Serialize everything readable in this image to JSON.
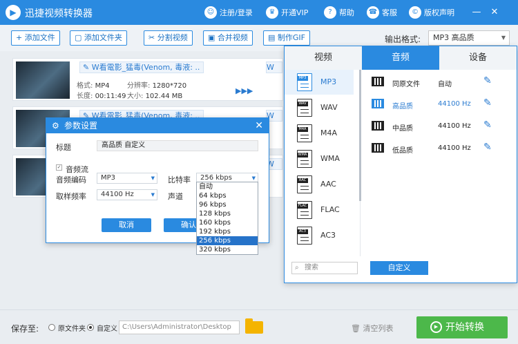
{
  "app": {
    "logo_glyph": "▶",
    "title": "迅捷视频转换器"
  },
  "titlebar": {
    "links": [
      {
        "icon": "user-icon",
        "glyph": "☺",
        "label": "注册/登录"
      },
      {
        "icon": "vip-icon",
        "glyph": "♛",
        "label": "开通VIP"
      },
      {
        "icon": "help-icon",
        "glyph": "?",
        "label": "帮助"
      },
      {
        "icon": "headset-icon",
        "glyph": "☎",
        "label": "客服"
      },
      {
        "icon": "copyright-icon",
        "glyph": "©",
        "label": "版权声明"
      }
    ],
    "minimize": "—",
    "close": "✕"
  },
  "toolbar": {
    "add_file": "+ 添加文件",
    "add_folder": "添加文件夹",
    "split_video": "分割视频",
    "merge_video": "合并视频",
    "make_gif": "制作GIF",
    "output_format_label": "输出格式:",
    "output_format_value": "MP3  高品质"
  },
  "files": [
    {
      "name": "W看電影_猛毒(Venom, 毒液: ..",
      "format_k": "格式:",
      "format": "MP4",
      "res_k": "分辨率:",
      "res": "1280*720",
      "dur_k": "长度:",
      "dur": "00:11:49",
      "size_k": "大小:",
      "size": "102.44 MB",
      "out_name": "W"
    },
    {
      "name": "W看電影_猛毒(Venom, 毒液: ..",
      "out_name": "W"
    },
    {
      "name": "",
      "out_name": "W"
    }
  ],
  "dialog": {
    "title": "参数设置",
    "title_label": "标题",
    "title_value": "高品质 自定义",
    "audio_stream": "音频流",
    "audio_codec_label": "音频编码",
    "audio_codec_value": "MP3",
    "bitrate_label": "比特率",
    "bitrate_value": "256 kbps",
    "samplerate_label": "取样频率",
    "samplerate_value": "44100 Hz",
    "channel_label": "声道",
    "cancel": "取消",
    "confirm": "确认"
  },
  "bitrate_options": [
    "自动",
    "64 kbps",
    "96 kbps",
    "128 kbps",
    "160 kbps",
    "192 kbps",
    "256 kbps",
    "320 kbps"
  ],
  "bitrate_selected": "256 kbps",
  "format_panel": {
    "tabs": [
      "视频",
      "音频",
      "设备"
    ],
    "active_tab": "音频",
    "formats": [
      "MP3",
      "WAV",
      "M4A",
      "WMA",
      "AAC",
      "FLAC",
      "AC3"
    ],
    "selected_format": "MP3",
    "qualities": [
      {
        "name": "同原文件",
        "rate": "自动"
      },
      {
        "name": "高品质",
        "rate": "44100 Hz"
      },
      {
        "name": "中品质",
        "rate": "44100 Hz"
      },
      {
        "name": "低品质",
        "rate": "44100 Hz"
      }
    ],
    "selected_quality": "高品质",
    "search_placeholder": "搜索",
    "custom_button": "自定义"
  },
  "bottom": {
    "save_to": "保存至:",
    "original_folder": "原文件夹",
    "custom": "自定义",
    "path": "C:\\Users\\Administrator\\Desktop",
    "clear_list": "清空列表",
    "start": "开始转换"
  },
  "colors": {
    "accent": "#2a8ae0",
    "start_green": "#4cb84a",
    "selected_blue": "#2673c9",
    "folder_yellow": "#f4b400"
  }
}
